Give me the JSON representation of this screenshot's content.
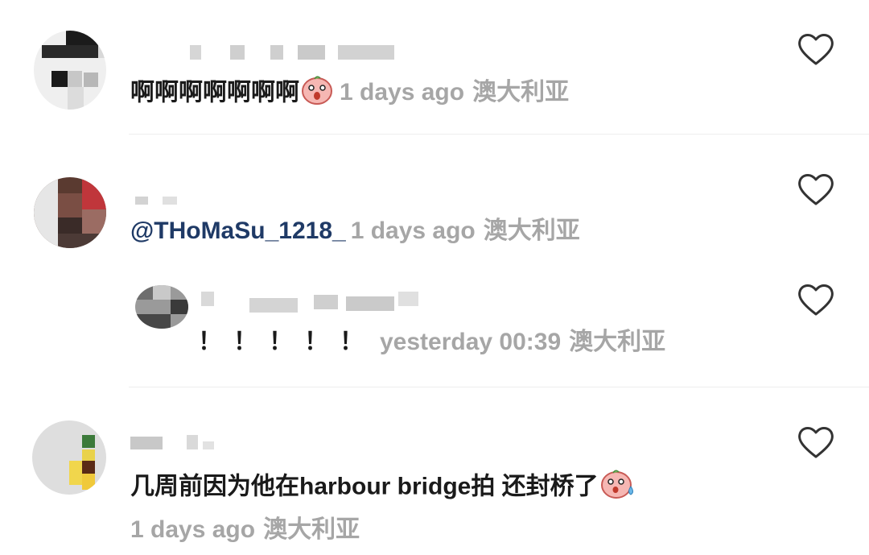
{
  "comments": [
    {
      "text": "啊啊啊啊啊啊啊",
      "time": "1 days ago",
      "region": "澳大利亚"
    },
    {
      "mention": "@THoMaSu_1218_",
      "time": "1 days ago",
      "region": "澳大利亚",
      "reply": {
        "text": "！！！！！",
        "time": "yesterday 00:39",
        "region": "澳大利亚"
      }
    },
    {
      "text": "几周前因为他在harbour bridge拍 还封桥了",
      "time": "1 days ago",
      "region": "澳大利亚"
    }
  ],
  "icons": {
    "like": "heart-outline-icon",
    "emoji_surprised": "surprised-pig-emoji-icon",
    "emoji_sweat": "sweat-pig-emoji-icon"
  },
  "colors": {
    "text": "#1a1a1a",
    "meta": "#a6a6a6",
    "mention": "#1f3a66",
    "heart": "#333333"
  }
}
